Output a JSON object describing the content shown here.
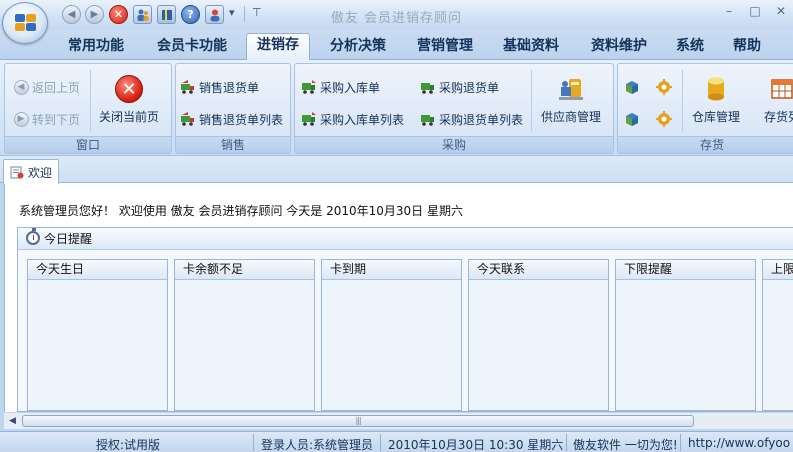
{
  "app": {
    "title": "傲友  会员进销存顾问",
    "win_minimize": "–",
    "win_maximize": "□",
    "win_close": "✕"
  },
  "quick_access": {
    "back": "◀",
    "forward": "▶",
    "close": "✕",
    "help": "?",
    "more": "▾"
  },
  "menu_tabs": [
    "常用功能",
    "会员卡功能",
    "进销存",
    "分析决策",
    "营销管理",
    "基础资料",
    "资料维护",
    "系统",
    "帮助"
  ],
  "active_tab": "进销存",
  "ribbon": {
    "window_group": {
      "label": "窗口",
      "back": "返回上页",
      "forward": "转到下页",
      "close_page": "关闭当前页"
    },
    "sales_group": {
      "label": "销售",
      "return": "销售退货单",
      "return_list": "销售退货单列表"
    },
    "purchase_group": {
      "label": "采购",
      "inbound": "采购入库单",
      "return": "采购退货单",
      "inbound_list": "采购入库单列表",
      "return_list": "采购退货单列表",
      "supplier": "供应商管理"
    },
    "stock_group": {
      "label": "存货",
      "warehouse": "仓库管理",
      "stock_query": "存货列"
    }
  },
  "doc_tab": {
    "label": "欢迎"
  },
  "welcome": {
    "text": "系统管理员您好！ 欢迎使用 傲友 会员进销存顾问 今天是 2010年10月30日 星期六"
  },
  "reminder": {
    "title": "今日提醒",
    "panels": [
      "今天生日",
      "卡余额不足",
      "卡到期",
      "今天联系",
      "下限提醒",
      "上限"
    ]
  },
  "scrollbar": {
    "left_arrow": "◀",
    "grip": "|||"
  },
  "status": {
    "license": "授权:试用版",
    "user": "登录人员:系统管理员",
    "datetime": "2010年10月30日 10:30 星期六",
    "slogan": "傲友软件 一切为您!",
    "url": "http://www.ofyoo"
  },
  "colors": {
    "accent": "#15325a",
    "close_red": "#d5170a",
    "ribbon_bg": "#d5e4f6"
  }
}
